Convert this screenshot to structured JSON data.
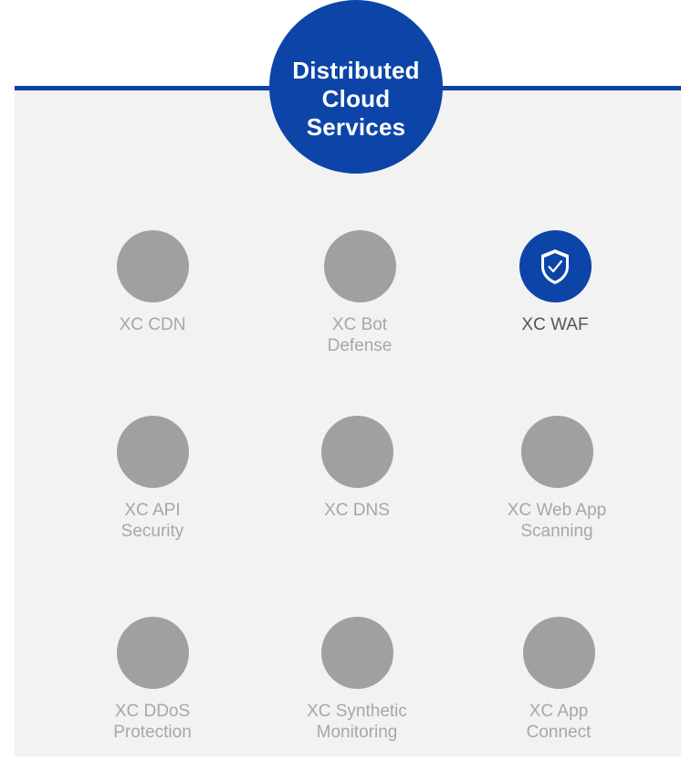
{
  "hub": {
    "lines": [
      "Distributed",
      "Cloud",
      "Services"
    ]
  },
  "colors": {
    "brand_blue": "#0d44a8",
    "inactive_circle": "#a0a0a0",
    "panel_background": "#f2f2f2",
    "inactive_text": "#a7a7a7",
    "active_text": "#555555"
  },
  "services": [
    {
      "lines": [
        "XC CDN"
      ],
      "active": false
    },
    {
      "lines": [
        "XC Bot",
        "Defense"
      ],
      "active": false
    },
    {
      "lines": [
        "XC WAF"
      ],
      "active": true,
      "icon": "shield-check-icon"
    },
    {
      "lines": [
        "XC API",
        "Security"
      ],
      "active": false
    },
    {
      "lines": [
        "XC DNS"
      ],
      "active": false
    },
    {
      "lines": [
        "XC Web App",
        "Scanning"
      ],
      "active": false
    },
    {
      "lines": [
        "XC DDoS",
        "Protection"
      ],
      "active": false
    },
    {
      "lines": [
        "XC Synthetic",
        "Monitoring"
      ],
      "active": false
    },
    {
      "lines": [
        "XC App",
        "Connect"
      ],
      "active": false
    }
  ]
}
